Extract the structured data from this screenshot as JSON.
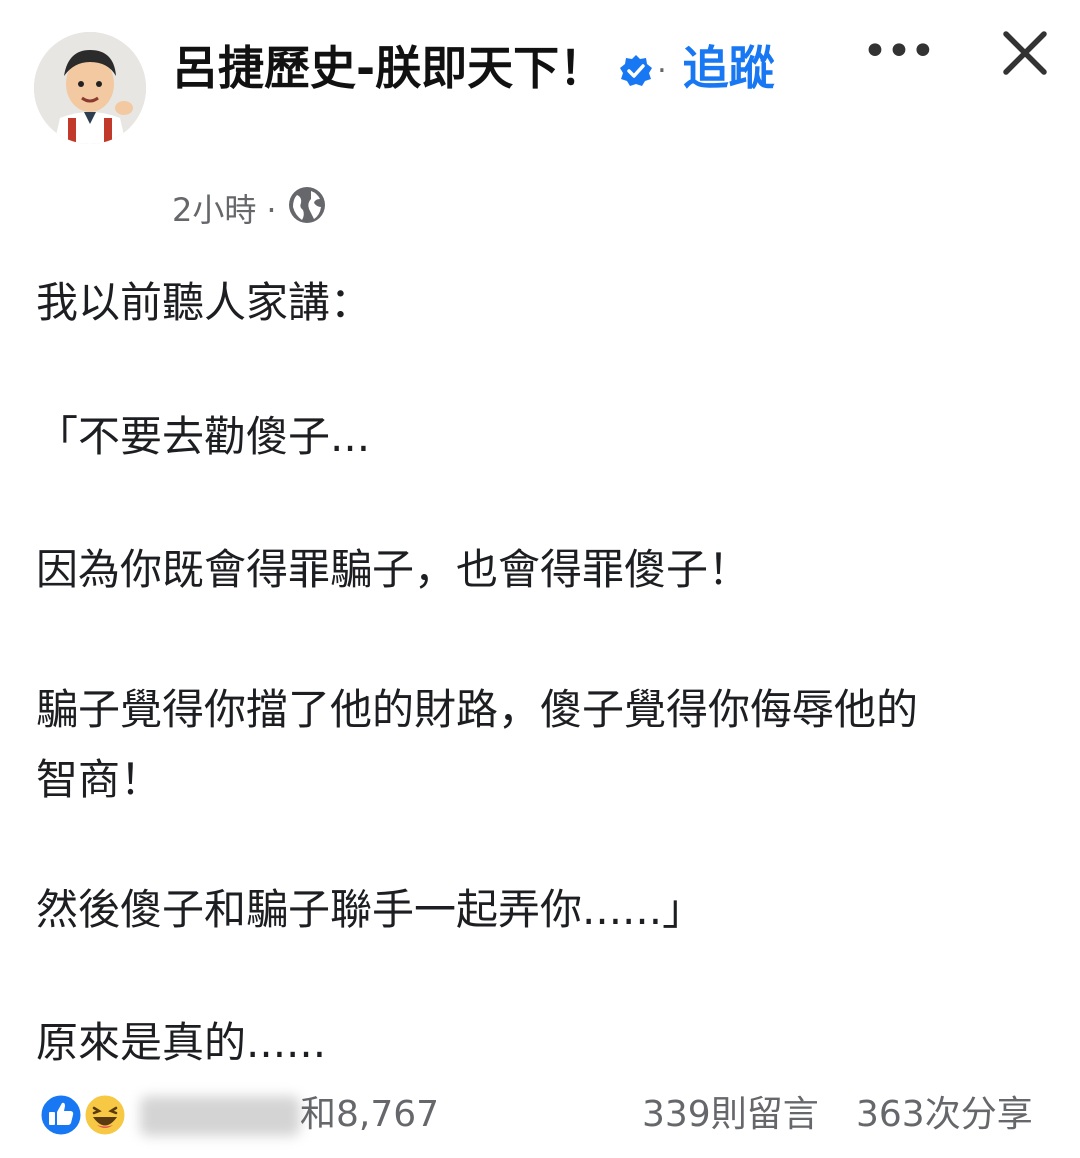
{
  "header": {
    "page_name": "呂捷歷史-朕即天下！",
    "separator": "·",
    "follow_label": "追蹤",
    "more_label": "•••"
  },
  "meta": {
    "time": "2小時",
    "separator": "·",
    "audience_icon": "globe-icon"
  },
  "post": {
    "paragraphs": [
      "我以前聽人家講：",
      "「不要去勸傻子...",
      "因為你既會得罪騙子，也會得罪傻子！",
      "騙子覺得你擋了他的財路，傻子覺得你侮辱他的\n智商！",
      "然後傻子和騙子聯手一起弄你......」",
      "原來是真的......"
    ]
  },
  "footer": {
    "reaction_icons": [
      "like-icon",
      "haha-icon"
    ],
    "reactions_text": "和8,767",
    "comments": "339則留言",
    "shares": "363次分享"
  },
  "colors": {
    "accent": "#1877f2",
    "meta_gray": "#65676b",
    "text": "#1c1e21"
  }
}
